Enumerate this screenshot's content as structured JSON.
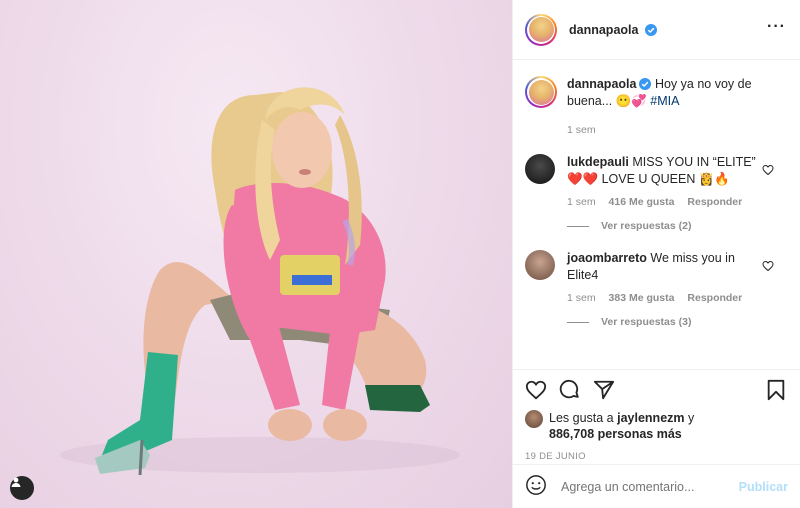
{
  "post": {
    "author": "dannapaola",
    "caption": "Hoy ya no voy de buena... 😶💞",
    "hashtag": "#MIA",
    "age": "1 sem",
    "date": "19 DE JUNIO",
    "likes_prefix": "Les gusta a",
    "likes_user": "jaylennezm",
    "likes_joiner": "y",
    "likes_count": "886,708 personas más"
  },
  "comments": [
    {
      "user": "lukdepauli",
      "text": "MISS YOU IN “ELITE” ❤️❤️ LOVE U QUEEN 👸🔥",
      "age": "1 sem",
      "likes": "416 Me gusta",
      "reply": "Responder",
      "view_replies": "Ver respuestas (2)"
    },
    {
      "user": "joaombarreto",
      "text": "We miss you in Elite4",
      "age": "1 sem",
      "likes": "383 Me gusta",
      "reply": "Responder",
      "view_replies": "Ver respuestas (3)"
    }
  ],
  "composer": {
    "placeholder": "Agrega un comentario...",
    "post_label": "Publicar"
  },
  "colors": {
    "verified": "#3897f0",
    "link": "#00376b",
    "muted": "#8e8e8e",
    "post_disabled": "#b2dffc"
  },
  "icons": [
    "user-tag-icon",
    "more-options-icon",
    "verified-badge-icon",
    "heart-icon",
    "comment-icon",
    "share-icon",
    "bookmark-icon",
    "emoji-icon"
  ]
}
